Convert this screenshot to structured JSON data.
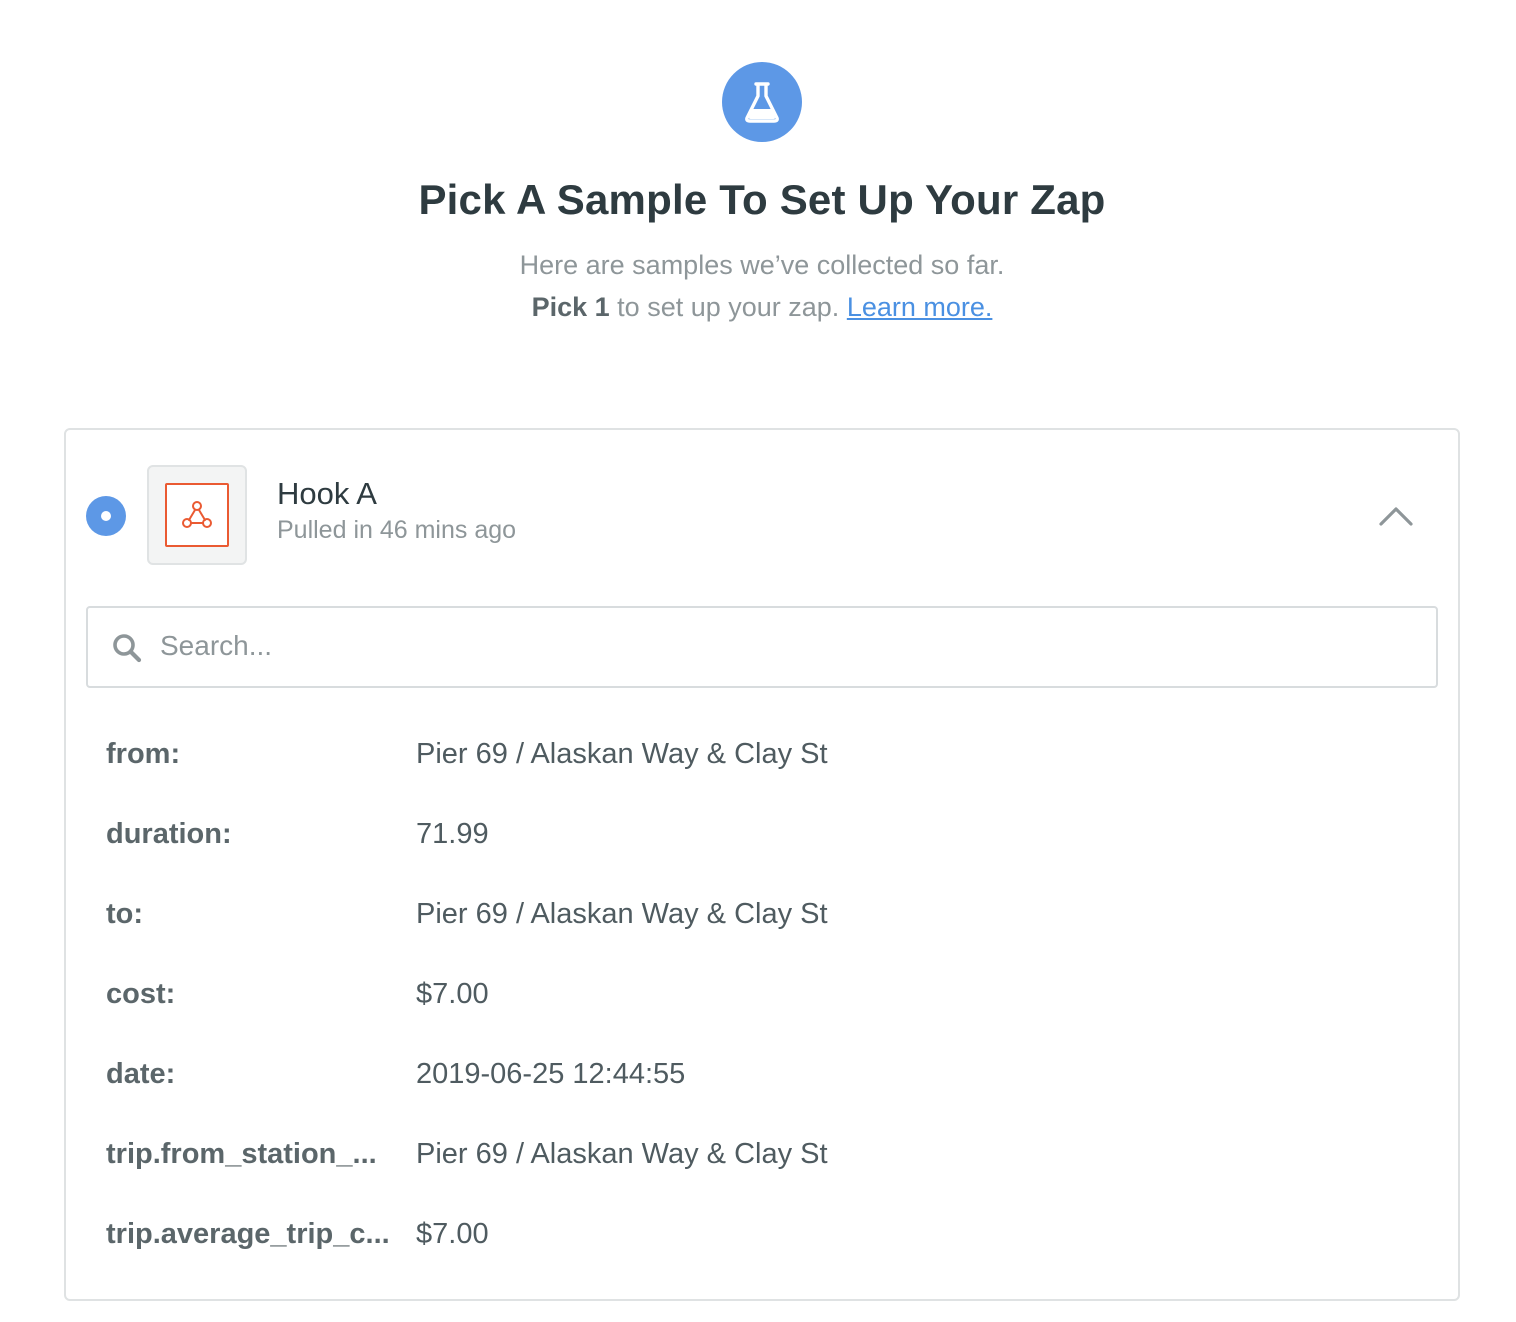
{
  "header": {
    "icon": "flask-icon",
    "title": "Pick A Sample To Set Up Your Zap",
    "subtitle_line1": "Here are samples we’ve collected so far.",
    "subtitle_bold": "Pick 1",
    "subtitle_rest": " to set up your zap. ",
    "learn_more": "Learn more."
  },
  "sample": {
    "selected": true,
    "app_icon": "webhook-icon",
    "title": "Hook A",
    "meta": "Pulled in 46 mins ago",
    "collapse_icon": "chevron-up-icon",
    "search": {
      "placeholder": "Search...",
      "value": ""
    },
    "fields": [
      {
        "key": "from:",
        "value": "Pier 69 / Alaskan Way & Clay St"
      },
      {
        "key": "duration:",
        "value": "71.99"
      },
      {
        "key": "to:",
        "value": "Pier 69 / Alaskan Way & Clay St"
      },
      {
        "key": "cost:",
        "value": "$7.00"
      },
      {
        "key": "date:",
        "value": "2019-06-25 12:44:55"
      },
      {
        "key": "trip.from_station_...",
        "value": "Pier 69 / Alaskan Way & Clay St"
      },
      {
        "key": "trip.average_trip_c...",
        "value": "$7.00"
      }
    ]
  },
  "colors": {
    "accent": "#5d98e6",
    "webhook": "#ea5a32",
    "link": "#4a90e2"
  }
}
